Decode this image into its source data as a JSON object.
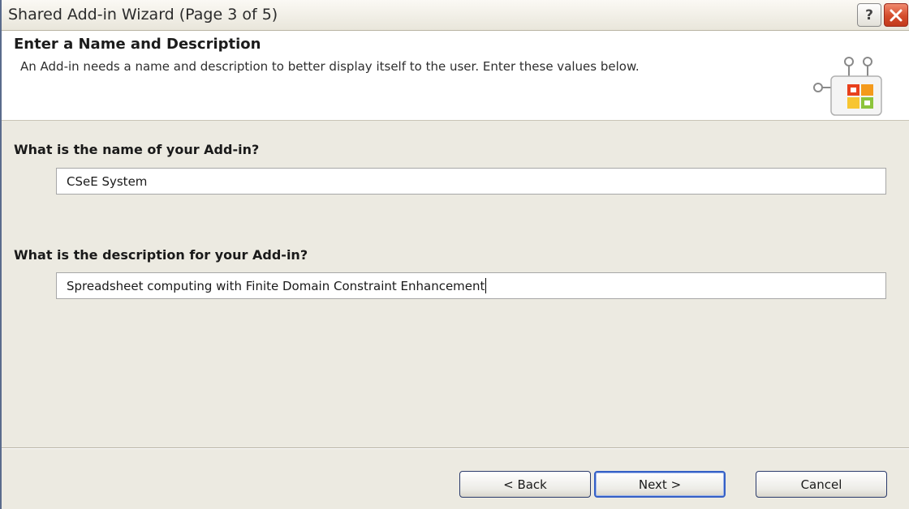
{
  "window": {
    "title": "Shared Add-in Wizard (Page 3 of 5)",
    "help_label": "?"
  },
  "header": {
    "title": "Enter a Name and Description",
    "description": "An Add-in needs a name and description to better display itself to the user. Enter these values below.",
    "icon": "office-addin-icon"
  },
  "form": {
    "name_label": "What is the name of your Add-in?",
    "name_value": "CSeE System",
    "description_label": "What is the description for your Add-in?",
    "description_value": "Spreadsheet computing with Finite Domain Constraint Enhancement"
  },
  "buttons": {
    "back": "< Back",
    "next": "Next >",
    "cancel": "Cancel"
  },
  "colors": {
    "window_face": "#eceae1",
    "header_background": "#ffffff",
    "close_button": "#d44c2c",
    "default_button_border": "#3560c6"
  }
}
